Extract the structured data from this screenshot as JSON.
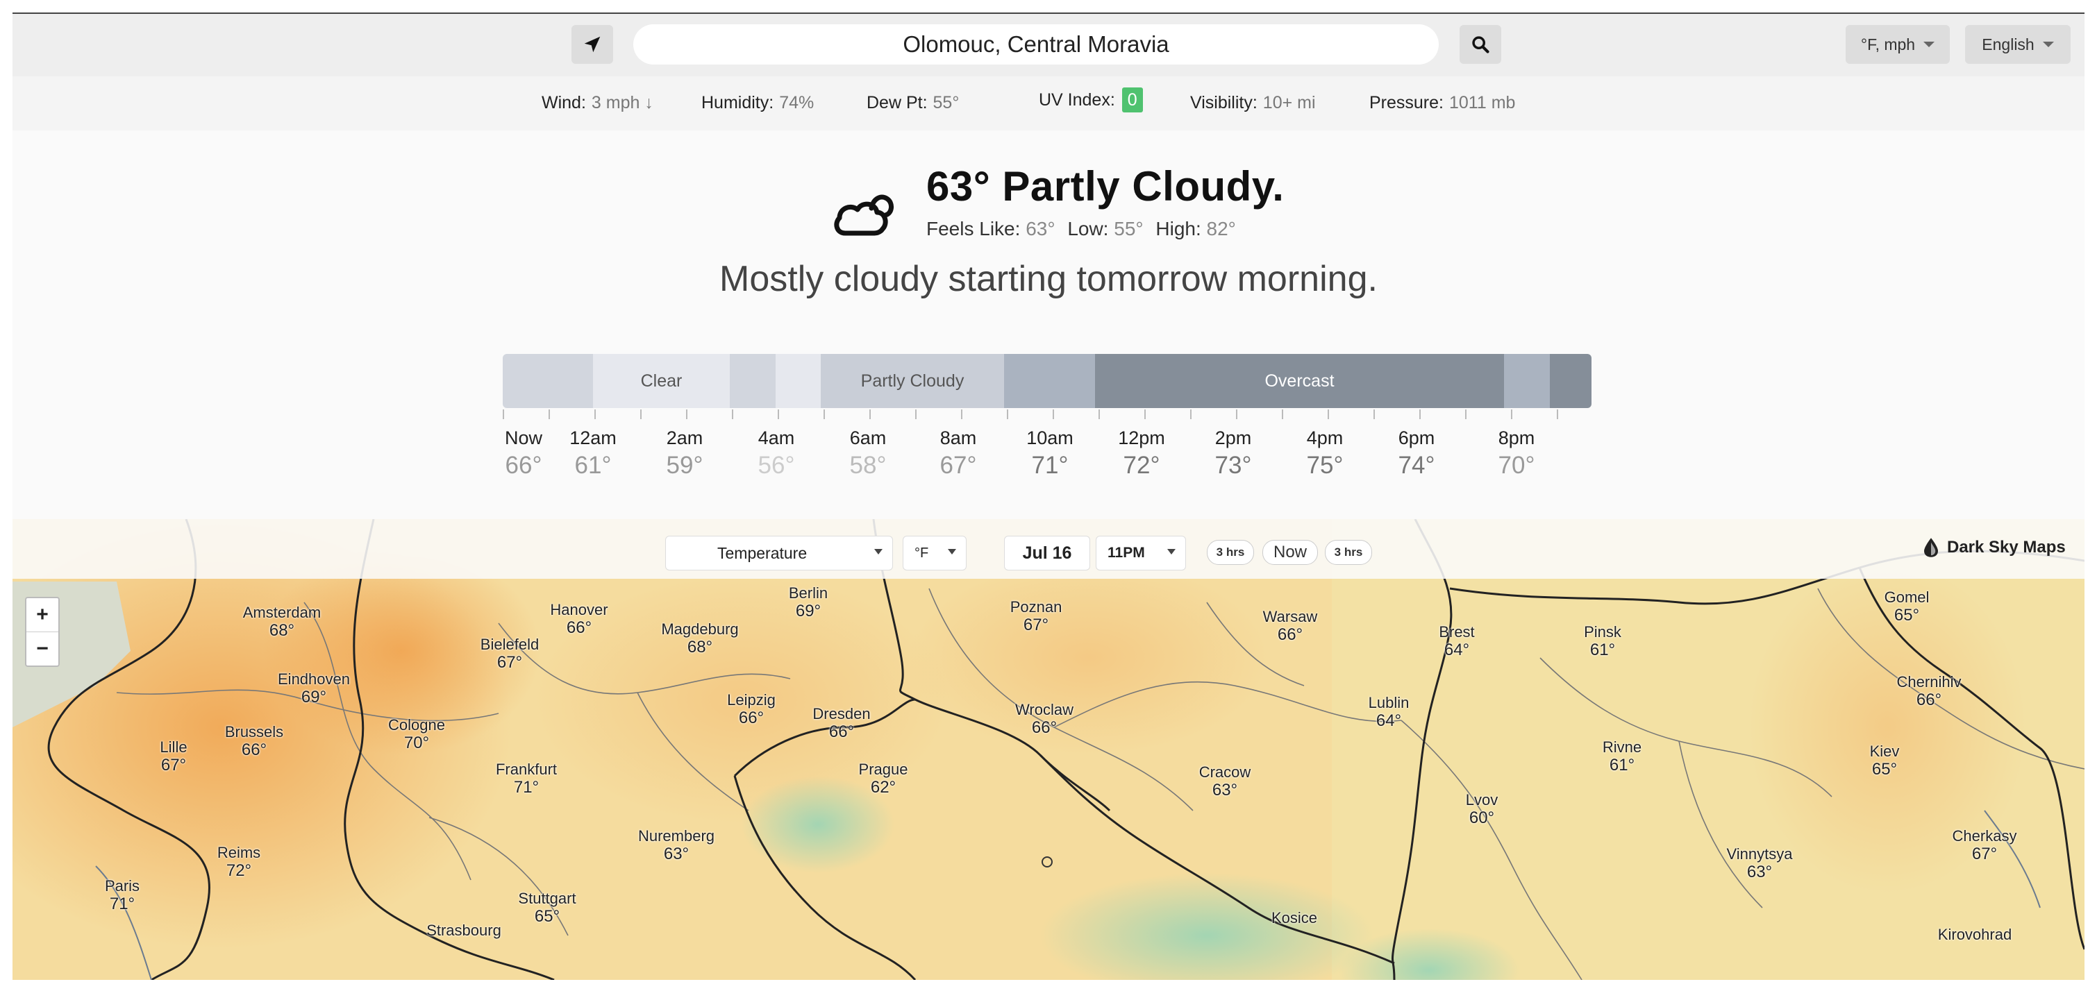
{
  "search": {
    "location": "Olomouc, Central Moravia"
  },
  "units_dropdown": "°F, mph",
  "language_dropdown": "English",
  "conditions": {
    "wind_label": "Wind:",
    "wind_value": "3 mph ↓",
    "humidity_label": "Humidity:",
    "humidity_value": "74%",
    "dewpt_label": "Dew Pt:",
    "dewpt_value": "55°",
    "uv_label": "UV Index:",
    "uv_value": "0",
    "visibility_label": "Visibility:",
    "visibility_value": "10+ mi",
    "pressure_label": "Pressure:",
    "pressure_value": "1011 mb"
  },
  "current": {
    "title": "63° Partly Cloudy.",
    "feels_label": "Feels Like:",
    "feels_value": "63°",
    "low_label": "Low:",
    "low_value": "55°",
    "high_label": "High:",
    "high_value": "82°",
    "summary": "Mostly cloudy starting tomorrow morning."
  },
  "timeline": {
    "segments": [
      {
        "label": "",
        "color": "#d2d6de"
      },
      {
        "label": "Clear",
        "color": "#e6e8ee"
      },
      {
        "label": "",
        "color": "#d2d6de"
      },
      {
        "label": "",
        "color": "#e6e8ee"
      },
      {
        "label": "Partly Cloudy",
        "color": "#c9ced7"
      },
      {
        "label": "",
        "color": "#aab3c0"
      },
      {
        "label": "Overcast",
        "color": "#858e99"
      },
      {
        "label": "",
        "color": "#aab3c0"
      },
      {
        "label": "",
        "color": "#858e99"
      }
    ],
    "hours": [
      {
        "time": "Now",
        "temp": "66°"
      },
      {
        "time": "12am",
        "temp": "61°"
      },
      {
        "time": "2am",
        "temp": "59°"
      },
      {
        "time": "4am",
        "temp": "56°"
      },
      {
        "time": "6am",
        "temp": "58°"
      },
      {
        "time": "8am",
        "temp": "67°"
      },
      {
        "time": "10am",
        "temp": "71°"
      },
      {
        "time": "12pm",
        "temp": "72°"
      },
      {
        "time": "2pm",
        "temp": "73°"
      },
      {
        "time": "4pm",
        "temp": "75°"
      },
      {
        "time": "6pm",
        "temp": "74°"
      },
      {
        "time": "8pm",
        "temp": "70°"
      }
    ]
  },
  "map": {
    "layer_select": "Temperature",
    "unit_select": "°F",
    "date": "Jul 16",
    "time_select": "11PM",
    "back_button": "3 hrs",
    "now_button": "Now",
    "forward_button": "3 hrs",
    "brand": "Dark Sky Maps",
    "zoom_in": "+",
    "zoom_out": "−",
    "cities": [
      {
        "name": "Amsterdam",
        "temp": "68°"
      },
      {
        "name": "Hanover",
        "temp": "66°"
      },
      {
        "name": "Berlin",
        "temp": "69°"
      },
      {
        "name": "Magdeburg",
        "temp": "68°"
      },
      {
        "name": "Bielefeld",
        "temp": "67°"
      },
      {
        "name": "Poznan",
        "temp": "67°"
      },
      {
        "name": "Warsaw",
        "temp": "66°"
      },
      {
        "name": "Brest",
        "temp": "64°"
      },
      {
        "name": "Pinsk",
        "temp": "61°"
      },
      {
        "name": "Gomel",
        "temp": "65°"
      },
      {
        "name": "Eindhoven",
        "temp": "69°"
      },
      {
        "name": "Leipzig",
        "temp": "66°"
      },
      {
        "name": "Dresden",
        "temp": "66°"
      },
      {
        "name": "Wroclaw",
        "temp": "66°"
      },
      {
        "name": "Lublin",
        "temp": "64°"
      },
      {
        "name": "Chernihiv",
        "temp": "66°"
      },
      {
        "name": "Brussels",
        "temp": "66°"
      },
      {
        "name": "Lille",
        "temp": "67°"
      },
      {
        "name": "Cologne",
        "temp": "70°"
      },
      {
        "name": "Rivne",
        "temp": "61°"
      },
      {
        "name": "Kiev",
        "temp": "65°"
      },
      {
        "name": "Frankfurt",
        "temp": "71°"
      },
      {
        "name": "Prague",
        "temp": "62°"
      },
      {
        "name": "Cracow",
        "temp": "63°"
      },
      {
        "name": "Lvov",
        "temp": "60°"
      },
      {
        "name": "Nuremberg",
        "temp": "63°"
      },
      {
        "name": "Reims",
        "temp": "72°"
      },
      {
        "name": "Vinnytsya",
        "temp": "63°"
      },
      {
        "name": "Cherkasy",
        "temp": "67°"
      },
      {
        "name": "Paris",
        "temp": "71°"
      },
      {
        "name": "Stuttgart",
        "temp": "65°"
      },
      {
        "name": "Strasbourg",
        "temp": ""
      },
      {
        "name": "Kosice",
        "temp": ""
      },
      {
        "name": "Kirovohrad",
        "temp": ""
      }
    ]
  }
}
